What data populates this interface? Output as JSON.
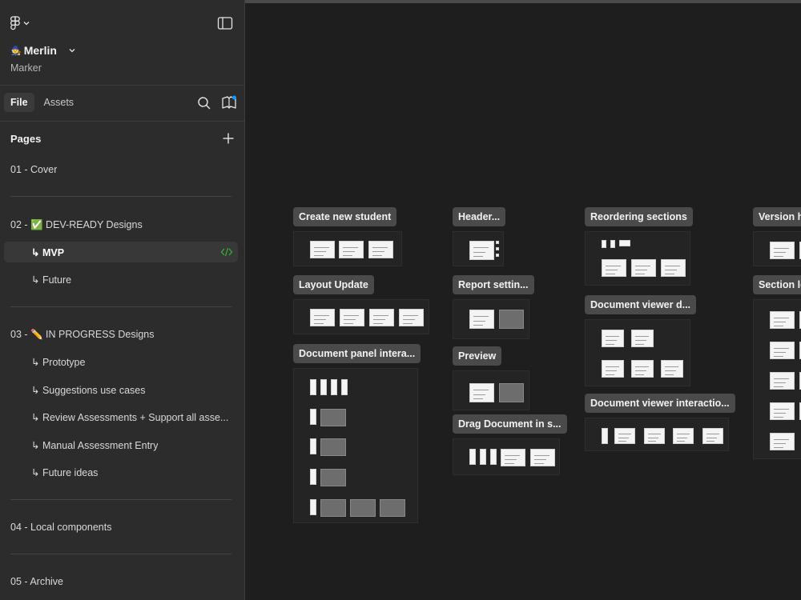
{
  "app": {
    "project_name": "Merlin",
    "project_emoji": "🧙",
    "team_name": "Marker",
    "accent_color": "#0d99ff",
    "check_color": "#2eb82e"
  },
  "tabs": [
    {
      "label": "File",
      "active": true
    },
    {
      "label": "Assets",
      "active": false
    }
  ],
  "pages_title": "Pages",
  "pages": [
    {
      "label": "01 - Cover"
    },
    {
      "label": "02 - ✅ DEV-READY Designs"
    },
    {
      "label": "↳ MVP",
      "selected": true
    },
    {
      "label": "↳ Future"
    },
    {
      "label": "03 - ✏️ IN PROGRESS Designs"
    },
    {
      "label": "↳ Prototype"
    },
    {
      "label": "↳ Suggestions use cases"
    },
    {
      "label": "↳ Review Assessments + Support all asse..."
    },
    {
      "label": "↳ Manual Assessment Entry"
    },
    {
      "label": "↳ Future ideas"
    },
    {
      "label": "04 - Local components"
    },
    {
      "label": "05 - Archive"
    }
  ],
  "canvas": {
    "sections": [
      {
        "label": "Create new student"
      },
      {
        "label": "Layout Update"
      },
      {
        "label": "Document panel intera..."
      },
      {
        "label": "Header..."
      },
      {
        "label": "Report settin..."
      },
      {
        "label": "Preview"
      },
      {
        "label": "Drag Document in s..."
      },
      {
        "label": "Reordering sections"
      },
      {
        "label": "Document viewer d..."
      },
      {
        "label": "Document viewer interactio..."
      },
      {
        "label": "Version h"
      },
      {
        "label": "Section le"
      }
    ]
  }
}
